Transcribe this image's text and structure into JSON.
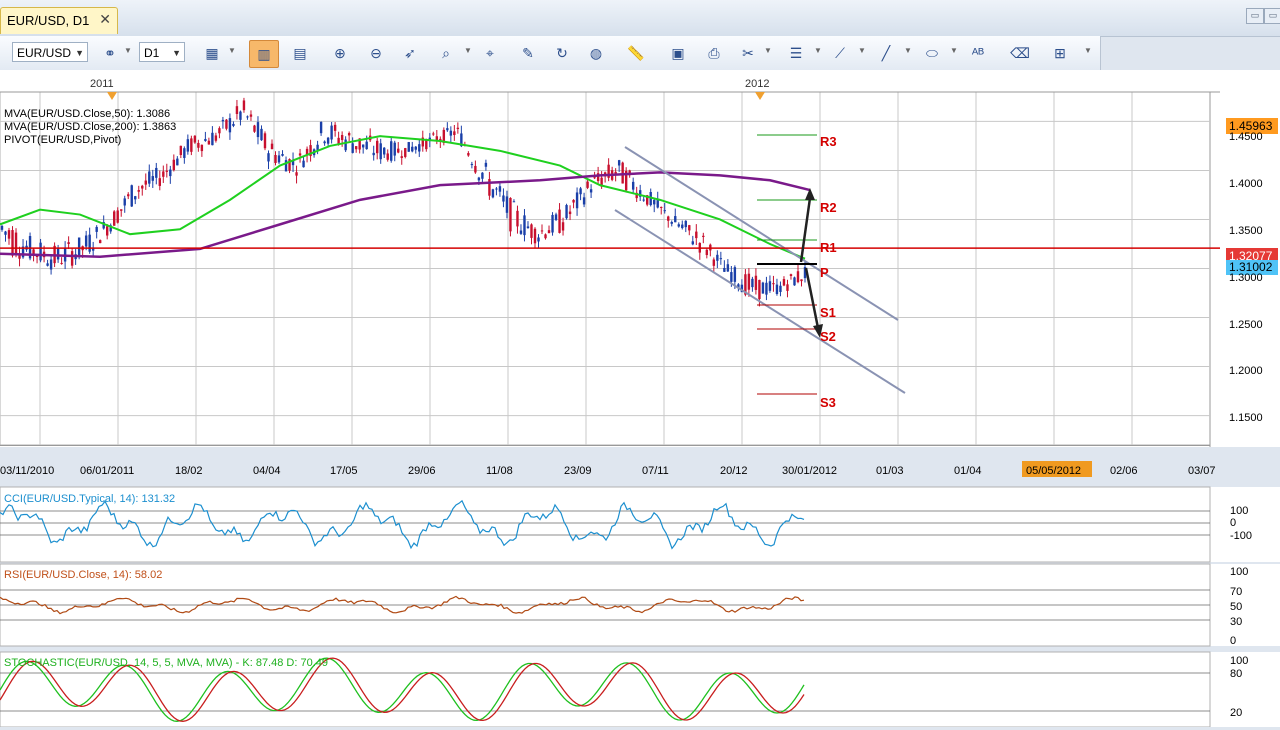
{
  "tab": {
    "title": "EUR/USD, D1",
    "close": "✕"
  },
  "window_buttons": [
    "▭",
    "▭"
  ],
  "toolbar": {
    "symbol": "EUR/USD",
    "timeframe": "D1",
    "icons": [
      "chart-type-icon",
      "candles-icon",
      "bars-icon",
      "zoom-in-icon",
      "zoom-out-icon",
      "cursor-icon",
      "magnifier-icon",
      "crosshair-icon",
      "edit-icon",
      "refresh-icon",
      "globe-icon",
      "ruler-icon",
      "image-icon",
      "screenshot-icon",
      "tools-icon",
      "lines-icon",
      "fibonacci-icon",
      "pen-icon",
      "ellipse-icon",
      "text-icon",
      "eraser-icon",
      "hierarchy-icon"
    ]
  },
  "colors": {
    "grid": "#c8c8c8",
    "bull": "#1a3fa8",
    "bear": "#c8102e",
    "ma50": "#1fd01f",
    "ma200": "#7a1a8a",
    "pivot_red": "#d40000",
    "pivot_green": "#1a9a1a",
    "channel": "#8a93b3",
    "price_tag": "#ff9a1f",
    "current_tag": "#4fc3f7",
    "red_tag": "#e53935"
  },
  "main": {
    "legend": [
      {
        "text": "MVA(EUR/USD.Close,50): 1.3086",
        "color": "#1fd01f"
      },
      {
        "text": "MVA(EUR/USD.Close,200): 1.3863",
        "color": "#7a1a8a"
      },
      {
        "text": "PIVOT(EUR/USD,Pivot)",
        "color": "#000000"
      }
    ],
    "years": [
      "2011",
      "2012"
    ],
    "price_ticks": [
      "1.4500",
      "1.4000",
      "1.3500",
      "1.3000",
      "1.2500",
      "1.2000",
      "1.1500"
    ],
    "price_tags": {
      "high": "1.45963",
      "red": "1.32077",
      "current": "1.31002"
    },
    "date_labels": [
      "03/11/2010",
      "06/01/2011",
      "18/02",
      "04/04",
      "17/05",
      "29/06",
      "11/08",
      "23/09",
      "07/11",
      "20/12",
      "30/01/2012",
      "01/03",
      "01/04",
      "05/05/2012",
      "02/06",
      "03/07"
    ],
    "pivots": [
      "R3",
      "R2",
      "R1",
      "P",
      "S1",
      "S2",
      "S3"
    ]
  },
  "cci": {
    "legend": "CCI(EUR/USD.Typical, 14): 131.32",
    "ticks": [
      "100",
      "0",
      "-100"
    ]
  },
  "rsi": {
    "legend": "RSI(EUR/USD.Close, 14): 58.02",
    "ticks": [
      "100",
      "70",
      "50",
      "30",
      "0"
    ]
  },
  "stoch": {
    "legend": "STOCHASTIC(EUR/USD, 14, 5, 5, MVA, MVA) - K: 87.48  D: 70.49",
    "ticks": [
      "100",
      "80",
      "20"
    ]
  },
  "chart_data": {
    "type": "candlestick",
    "symbol": "EUR/USD",
    "timeframe": "D1",
    "price_range": [
      1.12,
      1.48
    ],
    "candles_approx": [
      [
        1.38,
        1.3
      ],
      [
        1.34,
        1.3
      ],
      [
        1.33,
        1.29
      ],
      [
        1.34,
        1.3
      ],
      [
        1.36,
        1.33
      ],
      [
        1.4,
        1.36
      ],
      [
        1.41,
        1.38
      ],
      [
        1.44,
        1.41
      ],
      [
        1.45,
        1.42
      ],
      [
        1.48,
        1.44
      ],
      [
        1.44,
        1.4
      ],
      [
        1.42,
        1.39
      ],
      [
        1.46,
        1.42
      ],
      [
        1.45,
        1.41
      ],
      [
        1.44,
        1.4
      ],
      [
        1.43,
        1.41
      ],
      [
        1.44,
        1.42
      ],
      [
        1.45,
        1.43
      ],
      [
        1.42,
        1.37
      ],
      [
        1.38,
        1.33
      ],
      [
        1.35,
        1.32
      ],
      [
        1.37,
        1.33
      ],
      [
        1.4,
        1.37
      ],
      [
        1.42,
        1.38
      ],
      [
        1.39,
        1.36
      ],
      [
        1.36,
        1.34
      ],
      [
        1.35,
        1.31
      ],
      [
        1.31,
        1.29
      ],
      [
        1.3,
        1.26
      ],
      [
        1.29,
        1.27
      ],
      [
        1.31,
        1.28
      ]
    ],
    "indicators": {
      "MVA50": 1.3086,
      "MVA200": 1.3863,
      "CCI14": 131.32,
      "RSI14": 58.02,
      "STOCH_K": 87.48,
      "STOCH_D": 70.49
    },
    "levels": {
      "high_tag": 1.45963,
      "red_line": 1.32077,
      "current": 1.31002
    }
  }
}
